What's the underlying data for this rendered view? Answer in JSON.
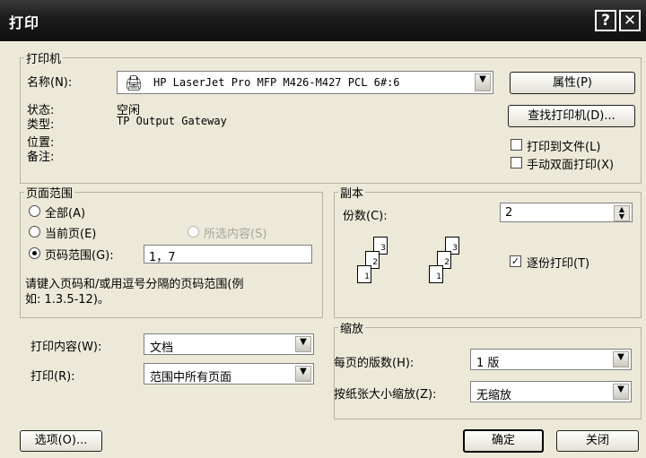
{
  "window": {
    "title": "打印",
    "help_label": "?",
    "close_label": "✕"
  },
  "printer": {
    "legend": "打印机",
    "name_label": "名称(N):",
    "name_value": "HP LaserJet Pro MFP M426-M427 PCL 6#:6",
    "status_label": "状态:",
    "status_value": "空闲",
    "type_label": "类型:",
    "type_value": "TP Output Gateway",
    "location_label": "位置:",
    "comment_label": "备注:",
    "properties_button": "属性(P)",
    "find_button": "查找打印机(D)...",
    "print_to_file_label": "打印到文件(L)",
    "print_to_file_checked": false,
    "duplex_label": "手动双面打印(X)",
    "duplex_checked": false
  },
  "page_range": {
    "legend": "页面范围",
    "all_label": "全部(A)",
    "current_label": "当前页(E)",
    "selection_label": "所选内容(S)",
    "pages_label": "页码范围(G):",
    "pages_value": "1，7",
    "selected": "pages",
    "hint_line1": "请键入页码和/或用逗号分隔的页码范围(例",
    "hint_line2": "如: 1.3.5-12)。"
  },
  "copies": {
    "legend": "副本",
    "count_label": "份数(C):",
    "count_value": "2",
    "collate_label": "逐份打印(T)",
    "collate_checked": true,
    "page_numbers": [
      "1",
      "2",
      "3"
    ]
  },
  "print_what": {
    "label": "打印内容(W):",
    "value": "文档",
    "print_label": "打印(R):",
    "print_value": "范围中所有页面"
  },
  "zoom": {
    "legend": "缩放",
    "pages_per_sheet_label": "每页的版数(H):",
    "pages_per_sheet_value": "1 版",
    "scale_label": "按纸张大小缩放(Z):",
    "scale_value": "无缩放"
  },
  "footer": {
    "options_button": "选项(O)...",
    "ok_button": "确定",
    "cancel_button": "关闭"
  }
}
